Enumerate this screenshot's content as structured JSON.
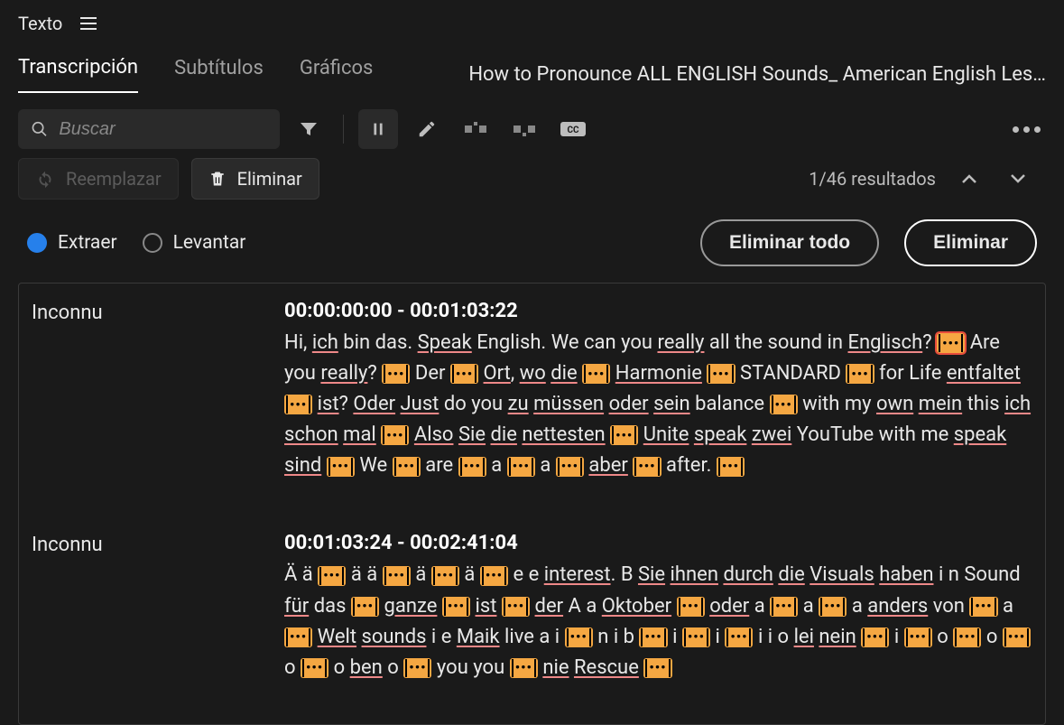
{
  "titlebar": {
    "title": "Texto"
  },
  "tabs": {
    "transcription": "Transcripción",
    "subtitles": "Subtítulos",
    "graphics": "Gráficos",
    "filename": "How to Pronounce ALL ENGLISH Sounds_ American English Les…"
  },
  "toolbar": {
    "search_placeholder": "Buscar",
    "replace_label": "Reemplazar",
    "delete_label": "Eliminar",
    "results_text": "1/46 resultados"
  },
  "radio": {
    "extract": "Extraer",
    "lift": "Levantar",
    "delete_all": "Eliminar todo",
    "delete": "Eliminar"
  },
  "segments": [
    {
      "speaker": "Inconnu",
      "timecode": "00:00:00:00 - 00:01:03:22",
      "tokens": [
        {
          "t": "Hi, "
        },
        {
          "t": "ich",
          "u": 1
        },
        {
          "t": " bin das. "
        },
        {
          "t": "Speak",
          "u": 1
        },
        {
          "t": " English. We can you "
        },
        {
          "t": "really",
          "u": 1
        },
        {
          "t": " all the sound in "
        },
        {
          "t": "Englisch",
          "u": 1
        },
        {
          "t": "? "
        },
        {
          "x": 1,
          "active": 1
        },
        {
          "t": " Are you "
        },
        {
          "t": "really",
          "u": 1
        },
        {
          "t": "? "
        },
        {
          "x": 1
        },
        {
          "t": " Der "
        },
        {
          "x": 1
        },
        {
          "t": " "
        },
        {
          "t": "Ort",
          "u": 1
        },
        {
          "t": ", "
        },
        {
          "t": "wo",
          "u": 1
        },
        {
          "t": " "
        },
        {
          "t": "die",
          "u": 1
        },
        {
          "t": " "
        },
        {
          "x": 1
        },
        {
          "t": " "
        },
        {
          "t": "Harmonie",
          "u": 1
        },
        {
          "t": " "
        },
        {
          "x": 1
        },
        {
          "t": " STANDARD "
        },
        {
          "x": 1
        },
        {
          "t": " for Life "
        },
        {
          "t": "entfaltet",
          "u": 1
        },
        {
          "t": " "
        },
        {
          "x": 1
        },
        {
          "t": " "
        },
        {
          "t": "ist",
          "u": 1
        },
        {
          "t": "? "
        },
        {
          "t": "Oder",
          "u": 1
        },
        {
          "t": " "
        },
        {
          "t": "Just",
          "u": 1
        },
        {
          "t": " do you "
        },
        {
          "t": "zu",
          "u": 1
        },
        {
          "t": " "
        },
        {
          "t": "müssen",
          "u": 1
        },
        {
          "t": " "
        },
        {
          "t": "oder",
          "u": 1
        },
        {
          "t": " "
        },
        {
          "t": "sein",
          "u": 1
        },
        {
          "t": " balance "
        },
        {
          "x": 1
        },
        {
          "t": " with my "
        },
        {
          "t": "own",
          "u": 1
        },
        {
          "t": " "
        },
        {
          "t": "mein",
          "u": 1
        },
        {
          "t": " this "
        },
        {
          "t": "ich",
          "u": 1
        },
        {
          "t": " "
        },
        {
          "t": "schon",
          "u": 1
        },
        {
          "t": " "
        },
        {
          "t": "mal",
          "u": 1
        },
        {
          "t": " "
        },
        {
          "x": 1
        },
        {
          "t": " "
        },
        {
          "t": "Also",
          "u": 1
        },
        {
          "t": " "
        },
        {
          "t": "Sie",
          "u": 1
        },
        {
          "t": " "
        },
        {
          "t": "die",
          "u": 1
        },
        {
          "t": " "
        },
        {
          "t": "nettesten",
          "u": 1
        },
        {
          "t": " "
        },
        {
          "x": 1
        },
        {
          "t": " "
        },
        {
          "t": "Unite",
          "u": 1
        },
        {
          "t": " "
        },
        {
          "t": "speak",
          "u": 1
        },
        {
          "t": " "
        },
        {
          "t": "zwei",
          "u": 1
        },
        {
          "t": " YouTube with me "
        },
        {
          "t": "speak",
          "u": 1
        },
        {
          "t": " "
        },
        {
          "t": "sind",
          "u": 1
        },
        {
          "t": " "
        },
        {
          "x": 1
        },
        {
          "t": " We "
        },
        {
          "x": 1
        },
        {
          "t": " are "
        },
        {
          "x": 1
        },
        {
          "t": " a "
        },
        {
          "x": 1
        },
        {
          "t": " a "
        },
        {
          "x": 1
        },
        {
          "t": " "
        },
        {
          "t": "aber",
          "u": 1
        },
        {
          "t": " "
        },
        {
          "x": 1
        },
        {
          "t": " after. "
        },
        {
          "x": 1
        }
      ]
    },
    {
      "speaker": "Inconnu",
      "timecode": "00:01:03:24 - 00:02:41:04",
      "tokens": [
        {
          "t": "Ä ä "
        },
        {
          "x": 1
        },
        {
          "t": " ä ä "
        },
        {
          "x": 1
        },
        {
          "t": " ä "
        },
        {
          "x": 1
        },
        {
          "t": " ä "
        },
        {
          "x": 1
        },
        {
          "t": " e e "
        },
        {
          "t": "interest",
          "u": 1
        },
        {
          "t": ". B "
        },
        {
          "t": "Sie",
          "u": 1
        },
        {
          "t": " "
        },
        {
          "t": "ihnen",
          "u": 1
        },
        {
          "t": " "
        },
        {
          "t": "durch",
          "u": 1
        },
        {
          "t": " "
        },
        {
          "t": "die",
          "u": 1
        },
        {
          "t": " "
        },
        {
          "t": "Visuals",
          "u": 1
        },
        {
          "t": " "
        },
        {
          "t": "haben",
          "u": 1
        },
        {
          "t": " i n Sound "
        },
        {
          "t": "für",
          "u": 1
        },
        {
          "t": " das "
        },
        {
          "x": 1
        },
        {
          "t": " "
        },
        {
          "t": "ganze",
          "u": 1
        },
        {
          "t": " "
        },
        {
          "x": 1
        },
        {
          "t": " "
        },
        {
          "t": "ist",
          "u": 1
        },
        {
          "t": " "
        },
        {
          "x": 1
        },
        {
          "t": " "
        },
        {
          "t": "der",
          "u": 1
        },
        {
          "t": " A a "
        },
        {
          "t": "Oktober",
          "u": 1
        },
        {
          "t": " "
        },
        {
          "x": 1
        },
        {
          "t": " "
        },
        {
          "t": "oder",
          "u": 1
        },
        {
          "t": " a "
        },
        {
          "x": 1
        },
        {
          "t": " a "
        },
        {
          "x": 1
        },
        {
          "t": " a "
        },
        {
          "t": "anders",
          "u": 1
        },
        {
          "t": " von "
        },
        {
          "x": 1
        },
        {
          "t": " a "
        },
        {
          "x": 1
        },
        {
          "t": " "
        },
        {
          "t": "Welt",
          "u": 1
        },
        {
          "t": " "
        },
        {
          "t": "sounds",
          "u": 1
        },
        {
          "t": " i e "
        },
        {
          "t": "Maik",
          "u": 1
        },
        {
          "t": " live a i "
        },
        {
          "x": 1
        },
        {
          "t": " n i b "
        },
        {
          "x": 1
        },
        {
          "t": " i "
        },
        {
          "x": 1
        },
        {
          "t": " i "
        },
        {
          "x": 1
        },
        {
          "t": " i i o "
        },
        {
          "t": "lei",
          "u": 1
        },
        {
          "t": " "
        },
        {
          "t": "nein",
          "u": 1
        },
        {
          "t": " "
        },
        {
          "x": 1
        },
        {
          "t": " i "
        },
        {
          "x": 1
        },
        {
          "t": " o "
        },
        {
          "x": 1
        },
        {
          "t": " o "
        },
        {
          "x": 1
        },
        {
          "t": " o "
        },
        {
          "x": 1
        },
        {
          "t": " o "
        },
        {
          "t": "ben",
          "u": 1
        },
        {
          "t": " o "
        },
        {
          "x": 1
        },
        {
          "t": " you you "
        },
        {
          "x": 1
        },
        {
          "t": " "
        },
        {
          "t": "nie",
          "u": 1
        },
        {
          "t": " "
        },
        {
          "t": "Rescue",
          "u": 1
        },
        {
          "t": " "
        },
        {
          "x": 1
        }
      ]
    }
  ]
}
